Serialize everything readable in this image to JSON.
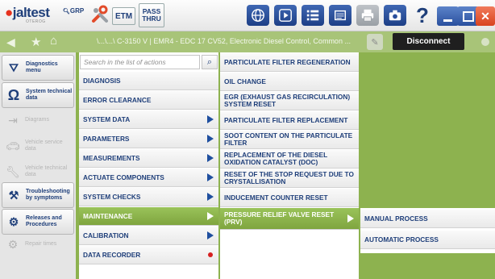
{
  "toolbar": {
    "logo": "jaltest",
    "logo_sub": "OTEROG",
    "grp": "GRP",
    "etm": "ETM",
    "pass_line1": "PASS",
    "pass_line2": "THRU",
    "icons": [
      "globe-icon",
      "play-icon",
      "list-icon",
      "document-icon",
      "print-icon",
      "camera-icon",
      "help-icon",
      "minimize-icon",
      "maximize-icon",
      "close-icon"
    ]
  },
  "navbar": {
    "breadcrumb": "\\...\\...\\ C-3150 V | EMR4 - EDC 17 CV52, Electronic Diesel Control, Common ...",
    "disconnect": "Disconnect"
  },
  "leftbar": [
    {
      "label": "Diagnostics menu",
      "icon": "diagnostics-icon",
      "state": "on"
    },
    {
      "label": "System technical data",
      "icon": "ohm-icon",
      "state": "on"
    },
    {
      "label": "Diagrams",
      "icon": "diagram-icon",
      "state": "off"
    },
    {
      "label": "Vehicle service data",
      "icon": "car-icon",
      "state": "off"
    },
    {
      "label": "Vehicle technical data",
      "icon": "wrench-icon",
      "state": "off"
    },
    {
      "label": "Troubleshooting by symptoms",
      "icon": "tools-icon",
      "state": "on"
    },
    {
      "label": "Releases and Procedures",
      "icon": "procedure-icon",
      "state": "on"
    },
    {
      "label": "Repair times",
      "icon": "gears-icon",
      "state": "off"
    }
  ],
  "search": {
    "placeholder": "Search in the list of actions"
  },
  "menu1": [
    {
      "label": "DIAGNOSIS",
      "arrow": false
    },
    {
      "label": "ERROR CLEARANCE",
      "arrow": false
    },
    {
      "label": "SYSTEM DATA",
      "arrow": true
    },
    {
      "label": "PARAMETERS",
      "arrow": true
    },
    {
      "label": "MEASUREMENTS",
      "arrow": true
    },
    {
      "label": "ACTUATE COMPONENTS",
      "arrow": true
    },
    {
      "label": "SYSTEM CHECKS",
      "arrow": true
    },
    {
      "label": "MAINTENANCE",
      "arrow": true,
      "selected": true
    },
    {
      "label": "CALIBRATION",
      "arrow": true
    },
    {
      "label": "DATA RECORDER",
      "dot": true
    }
  ],
  "menu2": [
    {
      "label": "PARTICULATE FILTER REGENERATION"
    },
    {
      "label": "OIL CHANGE"
    },
    {
      "label": "EGR (EXHAUST GAS RECIRCULATION) SYSTEM RESET"
    },
    {
      "label": "PARTICULATE FILTER REPLACEMENT"
    },
    {
      "label": "SOOT CONTENT ON THE PARTICULATE FILTER"
    },
    {
      "label": "REPLACEMENT OF THE DIESEL OXIDATION CATALYST (DOC)"
    },
    {
      "label": "RESET OF THE STOP REQUEST DUE TO CRYSTALLISATION"
    },
    {
      "label": "INDUCEMENT COUNTER RESET"
    },
    {
      "label": "PRESSURE RELIEF VALVE RESET (PRV)",
      "arrow": true,
      "selected": true
    }
  ],
  "menu3": [
    {
      "label": "MANUAL PROCESS"
    },
    {
      "label": "AUTOMATIC PROCESS"
    }
  ]
}
